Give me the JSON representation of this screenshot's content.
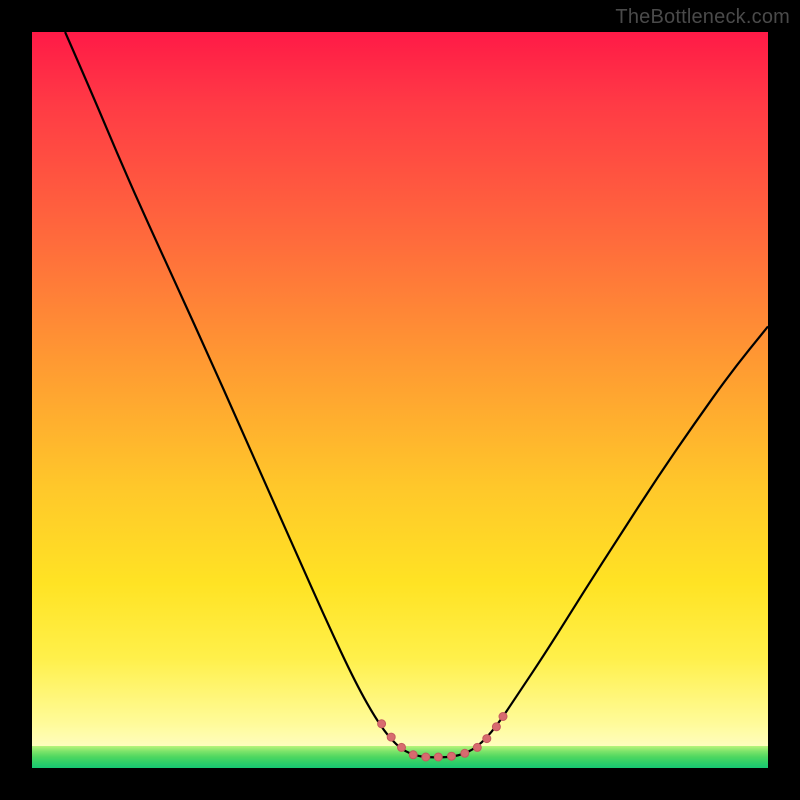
{
  "watermark": "TheBottleneck.com",
  "colors": {
    "background": "#000000",
    "gradient_top": "#ff1a47",
    "gradient_mid1": "#ff9a32",
    "gradient_mid2": "#ffe324",
    "gradient_bottom": "#ffffe0",
    "green_band_top": "#b8f47a",
    "green_band_bottom": "#17c772",
    "curve": "#000000",
    "marker_fill": "#d86b6f",
    "marker_stroke": "#c45a5e",
    "watermark_text": "#4a4a4a"
  },
  "chart_data": {
    "type": "line",
    "title": "",
    "xlabel": "",
    "ylabel": "",
    "xlim": [
      0,
      1
    ],
    "ylim": [
      0,
      1
    ],
    "grid": false,
    "legend": null,
    "curve_points": [
      {
        "x": 0.045,
        "y": 1.0
      },
      {
        "x": 0.08,
        "y": 0.92
      },
      {
        "x": 0.12,
        "y": 0.825
      },
      {
        "x": 0.16,
        "y": 0.735
      },
      {
        "x": 0.2,
        "y": 0.648
      },
      {
        "x": 0.24,
        "y": 0.56
      },
      {
        "x": 0.28,
        "y": 0.47
      },
      {
        "x": 0.32,
        "y": 0.38
      },
      {
        "x": 0.36,
        "y": 0.29
      },
      {
        "x": 0.4,
        "y": 0.2
      },
      {
        "x": 0.44,
        "y": 0.115
      },
      {
        "x": 0.47,
        "y": 0.062
      },
      {
        "x": 0.495,
        "y": 0.03
      },
      {
        "x": 0.52,
        "y": 0.016
      },
      {
        "x": 0.55,
        "y": 0.014
      },
      {
        "x": 0.58,
        "y": 0.016
      },
      {
        "x": 0.605,
        "y": 0.028
      },
      {
        "x": 0.63,
        "y": 0.055
      },
      {
        "x": 0.66,
        "y": 0.1
      },
      {
        "x": 0.7,
        "y": 0.16
      },
      {
        "x": 0.75,
        "y": 0.24
      },
      {
        "x": 0.8,
        "y": 0.318
      },
      {
        "x": 0.85,
        "y": 0.395
      },
      {
        "x": 0.9,
        "y": 0.468
      },
      {
        "x": 0.95,
        "y": 0.538
      },
      {
        "x": 1.0,
        "y": 0.6
      }
    ],
    "markers": [
      {
        "x": 0.475,
        "y": 0.06
      },
      {
        "x": 0.488,
        "y": 0.042
      },
      {
        "x": 0.502,
        "y": 0.028
      },
      {
        "x": 0.518,
        "y": 0.018
      },
      {
        "x": 0.535,
        "y": 0.015
      },
      {
        "x": 0.552,
        "y": 0.015
      },
      {
        "x": 0.57,
        "y": 0.016
      },
      {
        "x": 0.588,
        "y": 0.02
      },
      {
        "x": 0.605,
        "y": 0.028
      },
      {
        "x": 0.618,
        "y": 0.04
      },
      {
        "x": 0.631,
        "y": 0.056
      },
      {
        "x": 0.64,
        "y": 0.07
      }
    ],
    "marker_size": 8
  }
}
